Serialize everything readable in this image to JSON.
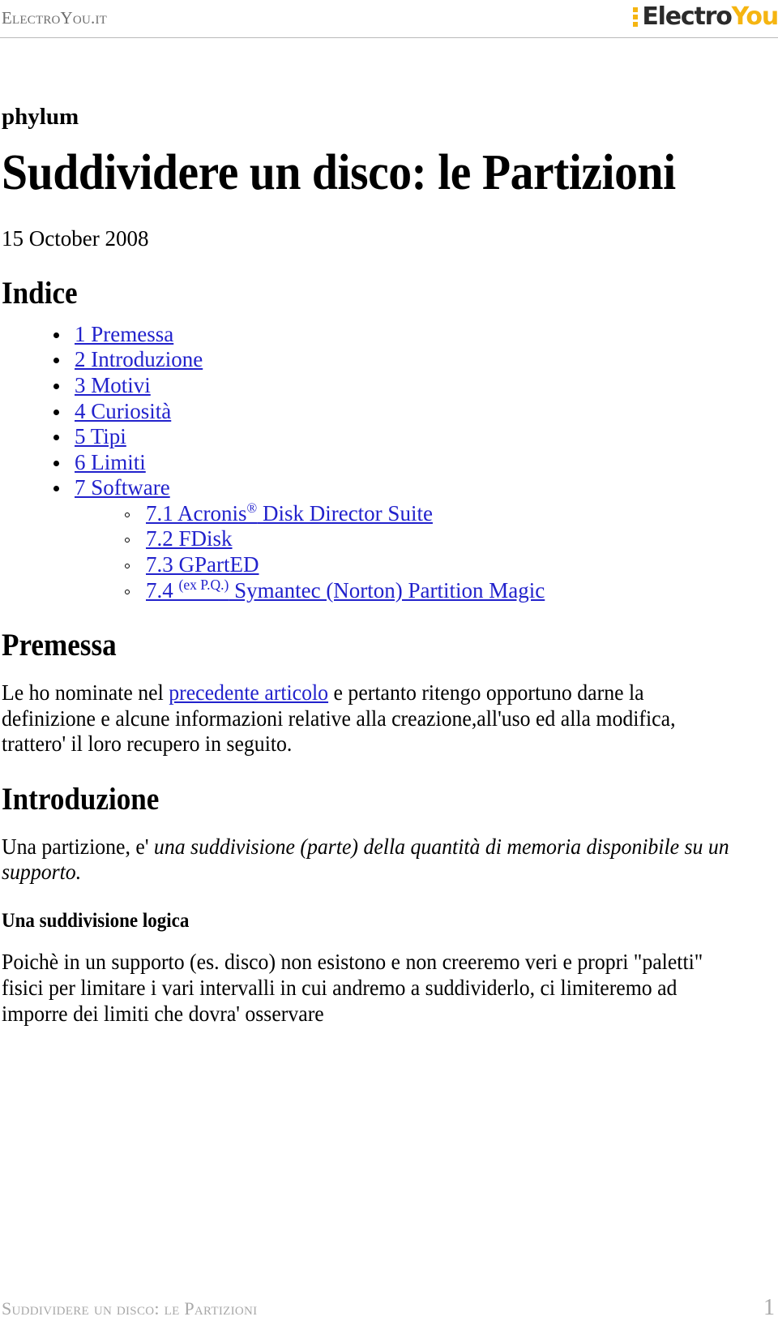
{
  "header": {
    "site_name": "ElectroYou.it",
    "logo": {
      "part1": "Electro",
      "part2": "You",
      "dot_color": "#f5b511",
      "part1_color": "#2b2b2b",
      "part2_color": "#f5b511"
    }
  },
  "article": {
    "author": "phylum",
    "title": "Suddividere un disco: le Partizioni",
    "date": "15 October 2008",
    "index_heading": "Indice",
    "toc": [
      {
        "label": "1 Premessa"
      },
      {
        "label": "2 Introduzione"
      },
      {
        "label": "3 Motivi"
      },
      {
        "label": "4 Curiosità"
      },
      {
        "label": "5 Tipi"
      },
      {
        "label": "6 Limiti"
      },
      {
        "label": "7 Software",
        "children": [
          {
            "prefix": "7.1 Acronis",
            "sup": "®",
            "suffix": " Disk Director Suite"
          },
          {
            "prefix": "7.2 FDisk",
            "sup": "",
            "suffix": ""
          },
          {
            "prefix": "7.3 GPartED",
            "sup": "",
            "suffix": ""
          },
          {
            "prefix": "7.4 ",
            "sup": "(ex P.Q.)",
            "suffix": " Symantec (Norton) Partition Magic"
          }
        ]
      }
    ],
    "sections": {
      "premessa": {
        "heading": "Premessa",
        "para_before_link": "Le ho nominate nel ",
        "link_text": "precedente articolo",
        "para_after_link": " e pertanto ritengo opportuno darne la definizione e alcune informazioni relative alla creazione,all'uso ed alla modifica, trattero' il loro recupero in seguito."
      },
      "introduzione": {
        "heading": "Introduzione",
        "para_plain": "Una partizione, e' ",
        "para_italic": "una suddivisione (parte) della quantità di memoria disponibile su un supporto.",
        "subheading": "Una suddivisione logica",
        "para2": "Poichè in un supporto (es. disco) non esistono e non creeremo veri e propri \"paletti\" fisici per limitare i vari intervalli in cui andremo a suddividerlo, ci limiteremo ad imporre dei limiti che dovra' osservare"
      }
    }
  },
  "footer": {
    "running_title": "Suddividere un disco: le Partizioni",
    "page_number": "1"
  },
  "colors": {
    "link": "#2222cc",
    "header_text": "#6d6d6d",
    "footer_text": "#a8a8a8",
    "rule": "#b9b9b9"
  }
}
